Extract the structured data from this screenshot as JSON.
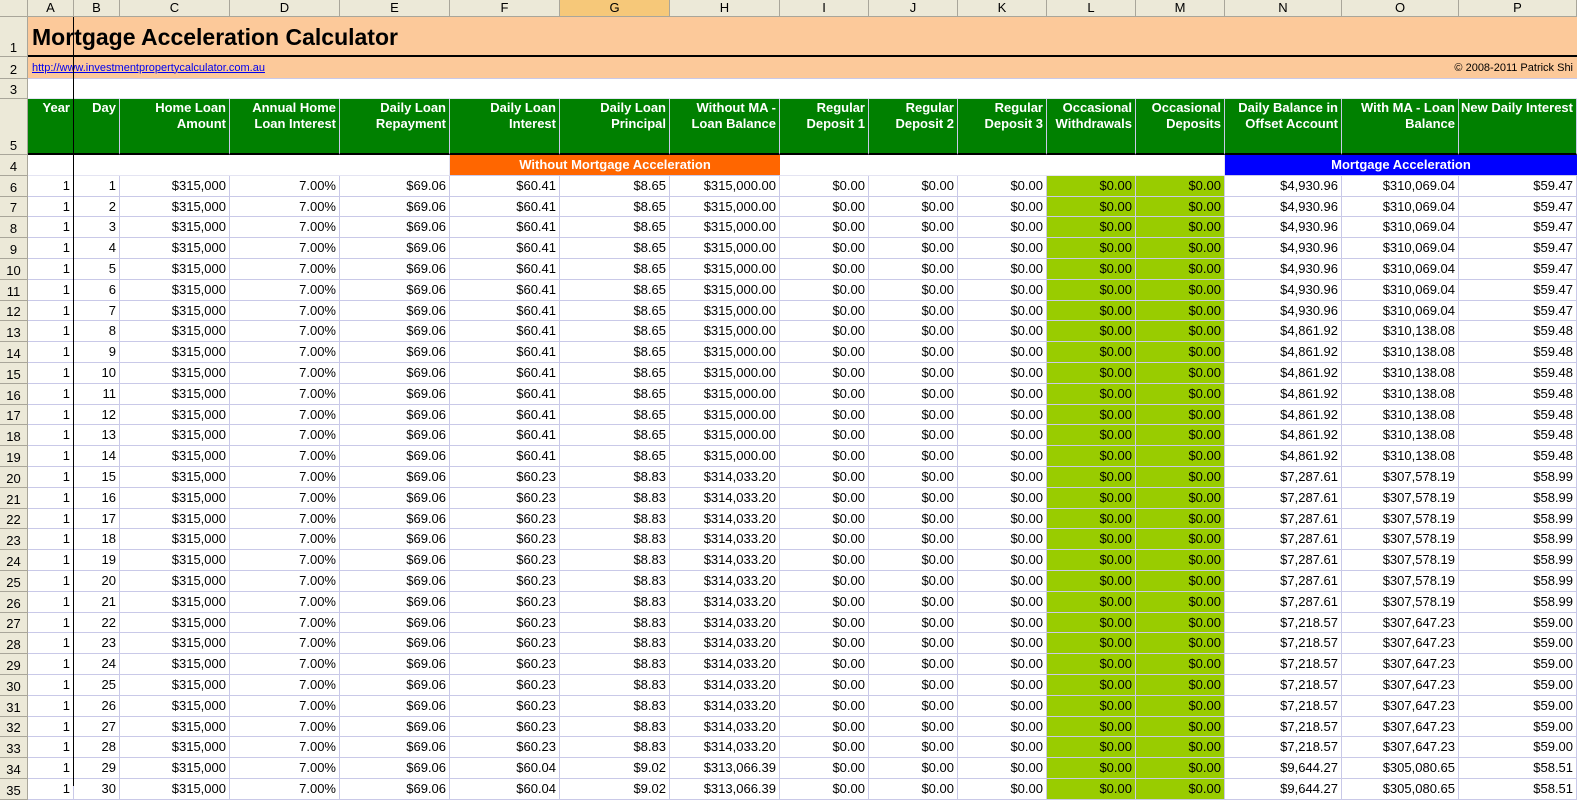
{
  "column_letters": [
    "A",
    "B",
    "C",
    "D",
    "E",
    "F",
    "G",
    "H",
    "I",
    "J",
    "K",
    "L",
    "M",
    "N",
    "O",
    "P"
  ],
  "selected_column": "G",
  "title": "Mortgage Acceleration Calculator",
  "link": "http://www.investmentpropertycalculator.com.au",
  "copyright": "© 2008-2011 Patrick Shi",
  "section_without": "Without Mortgage Acceleration",
  "section_with": "Mortgage Acceleration",
  "headers": [
    "Year",
    "Day",
    "Home Loan Amount",
    "Annual Home Loan Interest",
    "Daily Loan Repayment",
    "Daily Loan Interest",
    "Daily Loan Principal",
    "Without MA - Loan Balance",
    "Regular Deposit 1",
    "Regular Deposit 2",
    "Regular Deposit 3",
    "Occasional Withdrawals",
    "Occasional Deposits",
    "Daily Balance in Offset Account",
    "With MA - Loan Balance",
    "New Daily Interest"
  ],
  "colors": {
    "header_green": "#008000",
    "input_green": "#99cc00",
    "title_band": "#fcc99a",
    "without_section": "#ff6600",
    "with_section": "#0000ff"
  },
  "rows": [
    {
      "rownum": "6",
      "year": "1",
      "day": "1",
      "loan": "$315,000",
      "rate": "7.00%",
      "repay": "$69.06",
      "interest": "$60.41",
      "principal": "$8.65",
      "bal_without": "$315,000.00",
      "dep1": "$0.00",
      "dep2": "$0.00",
      "dep3": "$0.00",
      "withdrawals": "$0.00",
      "deposits": "$0.00",
      "offset": "$4,930.96",
      "bal_with": "$310,069.04",
      "new_interest": "$59.47"
    },
    {
      "rownum": "7",
      "year": "1",
      "day": "2",
      "loan": "$315,000",
      "rate": "7.00%",
      "repay": "$69.06",
      "interest": "$60.41",
      "principal": "$8.65",
      "bal_without": "$315,000.00",
      "dep1": "$0.00",
      "dep2": "$0.00",
      "dep3": "$0.00",
      "withdrawals": "$0.00",
      "deposits": "$0.00",
      "offset": "$4,930.96",
      "bal_with": "$310,069.04",
      "new_interest": "$59.47"
    },
    {
      "rownum": "8",
      "year": "1",
      "day": "3",
      "loan": "$315,000",
      "rate": "7.00%",
      "repay": "$69.06",
      "interest": "$60.41",
      "principal": "$8.65",
      "bal_without": "$315,000.00",
      "dep1": "$0.00",
      "dep2": "$0.00",
      "dep3": "$0.00",
      "withdrawals": "$0.00",
      "deposits": "$0.00",
      "offset": "$4,930.96",
      "bal_with": "$310,069.04",
      "new_interest": "$59.47"
    },
    {
      "rownum": "9",
      "year": "1",
      "day": "4",
      "loan": "$315,000",
      "rate": "7.00%",
      "repay": "$69.06",
      "interest": "$60.41",
      "principal": "$8.65",
      "bal_without": "$315,000.00",
      "dep1": "$0.00",
      "dep2": "$0.00",
      "dep3": "$0.00",
      "withdrawals": "$0.00",
      "deposits": "$0.00",
      "offset": "$4,930.96",
      "bal_with": "$310,069.04",
      "new_interest": "$59.47"
    },
    {
      "rownum": "10",
      "year": "1",
      "day": "5",
      "loan": "$315,000",
      "rate": "7.00%",
      "repay": "$69.06",
      "interest": "$60.41",
      "principal": "$8.65",
      "bal_without": "$315,000.00",
      "dep1": "$0.00",
      "dep2": "$0.00",
      "dep3": "$0.00",
      "withdrawals": "$0.00",
      "deposits": "$0.00",
      "offset": "$4,930.96",
      "bal_with": "$310,069.04",
      "new_interest": "$59.47"
    },
    {
      "rownum": "11",
      "year": "1",
      "day": "6",
      "loan": "$315,000",
      "rate": "7.00%",
      "repay": "$69.06",
      "interest": "$60.41",
      "principal": "$8.65",
      "bal_without": "$315,000.00",
      "dep1": "$0.00",
      "dep2": "$0.00",
      "dep3": "$0.00",
      "withdrawals": "$0.00",
      "deposits": "$0.00",
      "offset": "$4,930.96",
      "bal_with": "$310,069.04",
      "new_interest": "$59.47"
    },
    {
      "rownum": "12",
      "year": "1",
      "day": "7",
      "loan": "$315,000",
      "rate": "7.00%",
      "repay": "$69.06",
      "interest": "$60.41",
      "principal": "$8.65",
      "bal_without": "$315,000.00",
      "dep1": "$0.00",
      "dep2": "$0.00",
      "dep3": "$0.00",
      "withdrawals": "$0.00",
      "deposits": "$0.00",
      "offset": "$4,930.96",
      "bal_with": "$310,069.04",
      "new_interest": "$59.47"
    },
    {
      "rownum": "13",
      "year": "1",
      "day": "8",
      "loan": "$315,000",
      "rate": "7.00%",
      "repay": "$69.06",
      "interest": "$60.41",
      "principal": "$8.65",
      "bal_without": "$315,000.00",
      "dep1": "$0.00",
      "dep2": "$0.00",
      "dep3": "$0.00",
      "withdrawals": "$0.00",
      "deposits": "$0.00",
      "offset": "$4,861.92",
      "bal_with": "$310,138.08",
      "new_interest": "$59.48"
    },
    {
      "rownum": "14",
      "year": "1",
      "day": "9",
      "loan": "$315,000",
      "rate": "7.00%",
      "repay": "$69.06",
      "interest": "$60.41",
      "principal": "$8.65",
      "bal_without": "$315,000.00",
      "dep1": "$0.00",
      "dep2": "$0.00",
      "dep3": "$0.00",
      "withdrawals": "$0.00",
      "deposits": "$0.00",
      "offset": "$4,861.92",
      "bal_with": "$310,138.08",
      "new_interest": "$59.48"
    },
    {
      "rownum": "15",
      "year": "1",
      "day": "10",
      "loan": "$315,000",
      "rate": "7.00%",
      "repay": "$69.06",
      "interest": "$60.41",
      "principal": "$8.65",
      "bal_without": "$315,000.00",
      "dep1": "$0.00",
      "dep2": "$0.00",
      "dep3": "$0.00",
      "withdrawals": "$0.00",
      "deposits": "$0.00",
      "offset": "$4,861.92",
      "bal_with": "$310,138.08",
      "new_interest": "$59.48"
    },
    {
      "rownum": "16",
      "year": "1",
      "day": "11",
      "loan": "$315,000",
      "rate": "7.00%",
      "repay": "$69.06",
      "interest": "$60.41",
      "principal": "$8.65",
      "bal_without": "$315,000.00",
      "dep1": "$0.00",
      "dep2": "$0.00",
      "dep3": "$0.00",
      "withdrawals": "$0.00",
      "deposits": "$0.00",
      "offset": "$4,861.92",
      "bal_with": "$310,138.08",
      "new_interest": "$59.48"
    },
    {
      "rownum": "17",
      "year": "1",
      "day": "12",
      "loan": "$315,000",
      "rate": "7.00%",
      "repay": "$69.06",
      "interest": "$60.41",
      "principal": "$8.65",
      "bal_without": "$315,000.00",
      "dep1": "$0.00",
      "dep2": "$0.00",
      "dep3": "$0.00",
      "withdrawals": "$0.00",
      "deposits": "$0.00",
      "offset": "$4,861.92",
      "bal_with": "$310,138.08",
      "new_interest": "$59.48"
    },
    {
      "rownum": "18",
      "year": "1",
      "day": "13",
      "loan": "$315,000",
      "rate": "7.00%",
      "repay": "$69.06",
      "interest": "$60.41",
      "principal": "$8.65",
      "bal_without": "$315,000.00",
      "dep1": "$0.00",
      "dep2": "$0.00",
      "dep3": "$0.00",
      "withdrawals": "$0.00",
      "deposits": "$0.00",
      "offset": "$4,861.92",
      "bal_with": "$310,138.08",
      "new_interest": "$59.48"
    },
    {
      "rownum": "19",
      "year": "1",
      "day": "14",
      "loan": "$315,000",
      "rate": "7.00%",
      "repay": "$69.06",
      "interest": "$60.41",
      "principal": "$8.65",
      "bal_without": "$315,000.00",
      "dep1": "$0.00",
      "dep2": "$0.00",
      "dep3": "$0.00",
      "withdrawals": "$0.00",
      "deposits": "$0.00",
      "offset": "$4,861.92",
      "bal_with": "$310,138.08",
      "new_interest": "$59.48"
    },
    {
      "rownum": "20",
      "year": "1",
      "day": "15",
      "loan": "$315,000",
      "rate": "7.00%",
      "repay": "$69.06",
      "interest": "$60.23",
      "principal": "$8.83",
      "bal_without": "$314,033.20",
      "dep1": "$0.00",
      "dep2": "$0.00",
      "dep3": "$0.00",
      "withdrawals": "$0.00",
      "deposits": "$0.00",
      "offset": "$7,287.61",
      "bal_with": "$307,578.19",
      "new_interest": "$58.99"
    },
    {
      "rownum": "21",
      "year": "1",
      "day": "16",
      "loan": "$315,000",
      "rate": "7.00%",
      "repay": "$69.06",
      "interest": "$60.23",
      "principal": "$8.83",
      "bal_without": "$314,033.20",
      "dep1": "$0.00",
      "dep2": "$0.00",
      "dep3": "$0.00",
      "withdrawals": "$0.00",
      "deposits": "$0.00",
      "offset": "$7,287.61",
      "bal_with": "$307,578.19",
      "new_interest": "$58.99"
    },
    {
      "rownum": "22",
      "year": "1",
      "day": "17",
      "loan": "$315,000",
      "rate": "7.00%",
      "repay": "$69.06",
      "interest": "$60.23",
      "principal": "$8.83",
      "bal_without": "$314,033.20",
      "dep1": "$0.00",
      "dep2": "$0.00",
      "dep3": "$0.00",
      "withdrawals": "$0.00",
      "deposits": "$0.00",
      "offset": "$7,287.61",
      "bal_with": "$307,578.19",
      "new_interest": "$58.99"
    },
    {
      "rownum": "23",
      "year": "1",
      "day": "18",
      "loan": "$315,000",
      "rate": "7.00%",
      "repay": "$69.06",
      "interest": "$60.23",
      "principal": "$8.83",
      "bal_without": "$314,033.20",
      "dep1": "$0.00",
      "dep2": "$0.00",
      "dep3": "$0.00",
      "withdrawals": "$0.00",
      "deposits": "$0.00",
      "offset": "$7,287.61",
      "bal_with": "$307,578.19",
      "new_interest": "$58.99"
    },
    {
      "rownum": "24",
      "year": "1",
      "day": "19",
      "loan": "$315,000",
      "rate": "7.00%",
      "repay": "$69.06",
      "interest": "$60.23",
      "principal": "$8.83",
      "bal_without": "$314,033.20",
      "dep1": "$0.00",
      "dep2": "$0.00",
      "dep3": "$0.00",
      "withdrawals": "$0.00",
      "deposits": "$0.00",
      "offset": "$7,287.61",
      "bal_with": "$307,578.19",
      "new_interest": "$58.99"
    },
    {
      "rownum": "25",
      "year": "1",
      "day": "20",
      "loan": "$315,000",
      "rate": "7.00%",
      "repay": "$69.06",
      "interest": "$60.23",
      "principal": "$8.83",
      "bal_without": "$314,033.20",
      "dep1": "$0.00",
      "dep2": "$0.00",
      "dep3": "$0.00",
      "withdrawals": "$0.00",
      "deposits": "$0.00",
      "offset": "$7,287.61",
      "bal_with": "$307,578.19",
      "new_interest": "$58.99"
    },
    {
      "rownum": "26",
      "year": "1",
      "day": "21",
      "loan": "$315,000",
      "rate": "7.00%",
      "repay": "$69.06",
      "interest": "$60.23",
      "principal": "$8.83",
      "bal_without": "$314,033.20",
      "dep1": "$0.00",
      "dep2": "$0.00",
      "dep3": "$0.00",
      "withdrawals": "$0.00",
      "deposits": "$0.00",
      "offset": "$7,287.61",
      "bal_with": "$307,578.19",
      "new_interest": "$58.99"
    },
    {
      "rownum": "27",
      "year": "1",
      "day": "22",
      "loan": "$315,000",
      "rate": "7.00%",
      "repay": "$69.06",
      "interest": "$60.23",
      "principal": "$8.83",
      "bal_without": "$314,033.20",
      "dep1": "$0.00",
      "dep2": "$0.00",
      "dep3": "$0.00",
      "withdrawals": "$0.00",
      "deposits": "$0.00",
      "offset": "$7,218.57",
      "bal_with": "$307,647.23",
      "new_interest": "$59.00"
    },
    {
      "rownum": "28",
      "year": "1",
      "day": "23",
      "loan": "$315,000",
      "rate": "7.00%",
      "repay": "$69.06",
      "interest": "$60.23",
      "principal": "$8.83",
      "bal_without": "$314,033.20",
      "dep1": "$0.00",
      "dep2": "$0.00",
      "dep3": "$0.00",
      "withdrawals": "$0.00",
      "deposits": "$0.00",
      "offset": "$7,218.57",
      "bal_with": "$307,647.23",
      "new_interest": "$59.00"
    },
    {
      "rownum": "29",
      "year": "1",
      "day": "24",
      "loan": "$315,000",
      "rate": "7.00%",
      "repay": "$69.06",
      "interest": "$60.23",
      "principal": "$8.83",
      "bal_without": "$314,033.20",
      "dep1": "$0.00",
      "dep2": "$0.00",
      "dep3": "$0.00",
      "withdrawals": "$0.00",
      "deposits": "$0.00",
      "offset": "$7,218.57",
      "bal_with": "$307,647.23",
      "new_interest": "$59.00"
    },
    {
      "rownum": "30",
      "year": "1",
      "day": "25",
      "loan": "$315,000",
      "rate": "7.00%",
      "repay": "$69.06",
      "interest": "$60.23",
      "principal": "$8.83",
      "bal_without": "$314,033.20",
      "dep1": "$0.00",
      "dep2": "$0.00",
      "dep3": "$0.00",
      "withdrawals": "$0.00",
      "deposits": "$0.00",
      "offset": "$7,218.57",
      "bal_with": "$307,647.23",
      "new_interest": "$59.00"
    },
    {
      "rownum": "31",
      "year": "1",
      "day": "26",
      "loan": "$315,000",
      "rate": "7.00%",
      "repay": "$69.06",
      "interest": "$60.23",
      "principal": "$8.83",
      "bal_without": "$314,033.20",
      "dep1": "$0.00",
      "dep2": "$0.00",
      "dep3": "$0.00",
      "withdrawals": "$0.00",
      "deposits": "$0.00",
      "offset": "$7,218.57",
      "bal_with": "$307,647.23",
      "new_interest": "$59.00"
    },
    {
      "rownum": "32",
      "year": "1",
      "day": "27",
      "loan": "$315,000",
      "rate": "7.00%",
      "repay": "$69.06",
      "interest": "$60.23",
      "principal": "$8.83",
      "bal_without": "$314,033.20",
      "dep1": "$0.00",
      "dep2": "$0.00",
      "dep3": "$0.00",
      "withdrawals": "$0.00",
      "deposits": "$0.00",
      "offset": "$7,218.57",
      "bal_with": "$307,647.23",
      "new_interest": "$59.00"
    },
    {
      "rownum": "33",
      "year": "1",
      "day": "28",
      "loan": "$315,000",
      "rate": "7.00%",
      "repay": "$69.06",
      "interest": "$60.23",
      "principal": "$8.83",
      "bal_without": "$314,033.20",
      "dep1": "$0.00",
      "dep2": "$0.00",
      "dep3": "$0.00",
      "withdrawals": "$0.00",
      "deposits": "$0.00",
      "offset": "$7,218.57",
      "bal_with": "$307,647.23",
      "new_interest": "$59.00"
    },
    {
      "rownum": "34",
      "year": "1",
      "day": "29",
      "loan": "$315,000",
      "rate": "7.00%",
      "repay": "$69.06",
      "interest": "$60.04",
      "principal": "$9.02",
      "bal_without": "$313,066.39",
      "dep1": "$0.00",
      "dep2": "$0.00",
      "dep3": "$0.00",
      "withdrawals": "$0.00",
      "deposits": "$0.00",
      "offset": "$9,644.27",
      "bal_with": "$305,080.65",
      "new_interest": "$58.51"
    },
    {
      "rownum": "35",
      "year": "1",
      "day": "30",
      "loan": "$315,000",
      "rate": "7.00%",
      "repay": "$69.06",
      "interest": "$60.04",
      "principal": "$9.02",
      "bal_without": "$313,066.39",
      "dep1": "$0.00",
      "dep2": "$0.00",
      "dep3": "$0.00",
      "withdrawals": "$0.00",
      "deposits": "$0.00",
      "offset": "$9,644.27",
      "bal_with": "$305,080.65",
      "new_interest": "$58.51"
    }
  ]
}
